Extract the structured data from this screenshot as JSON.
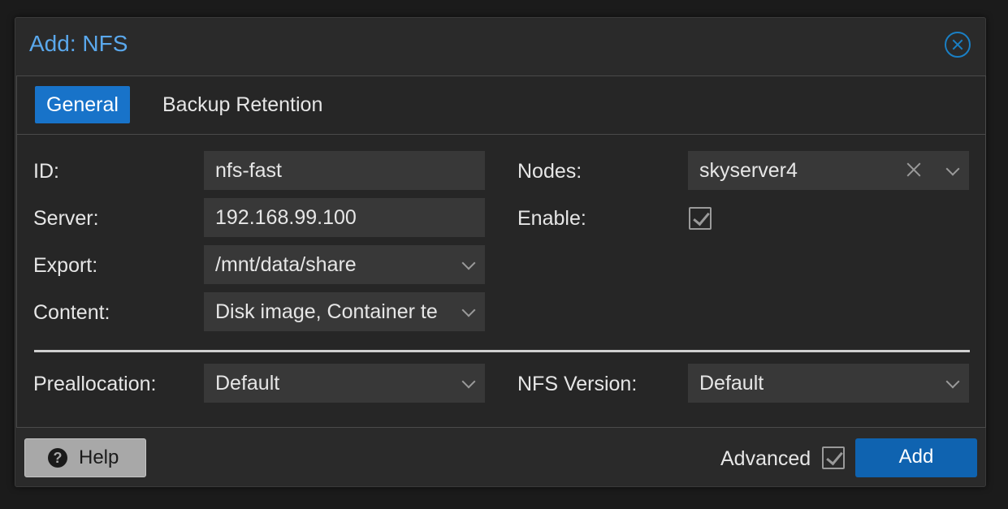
{
  "dialog": {
    "title": "Add: NFS",
    "close_icon": "close-circle-icon"
  },
  "tabs": [
    {
      "label": "General",
      "active": true
    },
    {
      "label": "Backup Retention",
      "active": false
    }
  ],
  "form": {
    "id": {
      "label": "ID:",
      "value": "nfs-fast"
    },
    "server": {
      "label": "Server:",
      "value": "192.168.99.100"
    },
    "export": {
      "label": "Export:",
      "value": "/mnt/data/share"
    },
    "content": {
      "label": "Content:",
      "value": "Disk image, Container te"
    },
    "nodes": {
      "label": "Nodes:",
      "value": "skyserver4"
    },
    "enable": {
      "label": "Enable:",
      "checked": true
    },
    "preallocation": {
      "label": "Preallocation:",
      "value": "Default"
    },
    "nfs_version": {
      "label": "NFS Version:",
      "value": "Default"
    }
  },
  "footer": {
    "help_label": "Help",
    "advanced_label": "Advanced",
    "advanced_checked": true,
    "add_label": "Add"
  },
  "colors": {
    "accent": "#1873c9",
    "title": "#5aa8ec",
    "add_button": "#0f63b0"
  }
}
